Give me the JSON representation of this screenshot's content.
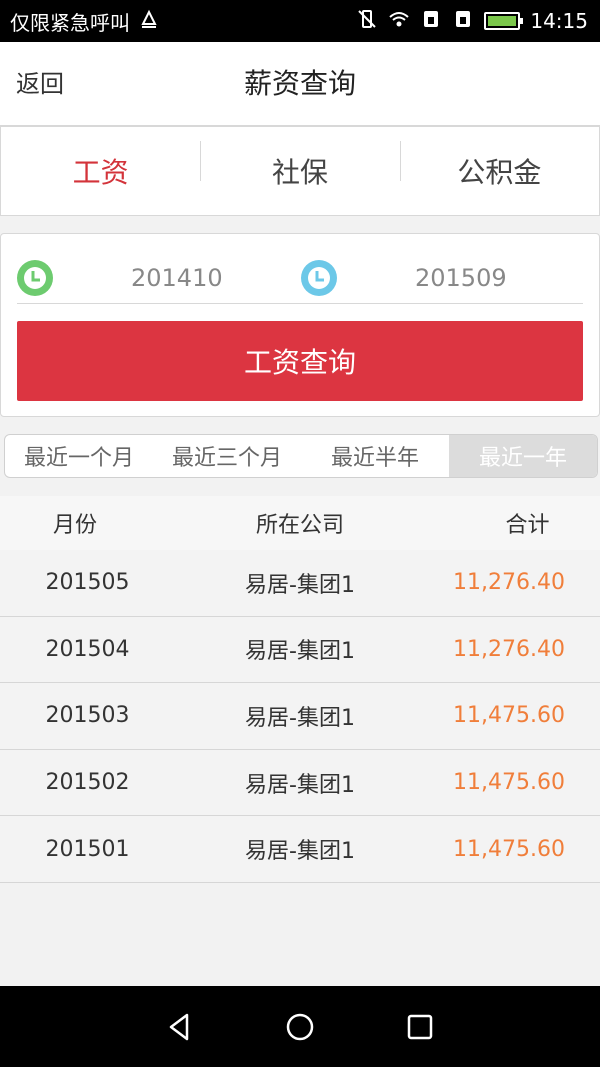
{
  "status_bar": {
    "carrier_text": "仅限紧急呼叫",
    "time": "14:15",
    "battery_color": "#7bc74b"
  },
  "header": {
    "back_label": "返回",
    "title": "薪资查询"
  },
  "tabs": [
    {
      "label": "工资",
      "active": true
    },
    {
      "label": "社保",
      "active": false
    },
    {
      "label": "公积金",
      "active": false
    }
  ],
  "query": {
    "start_date": "201410",
    "end_date": "201509",
    "button_label": "工资查询"
  },
  "ranges": [
    {
      "label": "最近一个月",
      "active": false
    },
    {
      "label": "最近三个月",
      "active": false
    },
    {
      "label": "最近半年",
      "active": false
    },
    {
      "label": "最近一年",
      "active": true
    }
  ],
  "table": {
    "headers": [
      "月份",
      "所在公司",
      "合计"
    ],
    "rows": [
      {
        "month": "201505",
        "company": "易居-集团1",
        "total": "11,276.40"
      },
      {
        "month": "201504",
        "company": "易居-集团1",
        "total": "11,276.40"
      },
      {
        "month": "201503",
        "company": "易居-集团1",
        "total": "11,475.60"
      },
      {
        "month": "201502",
        "company": "易居-集团1",
        "total": "11,475.60"
      },
      {
        "month": "201501",
        "company": "易居-集团1",
        "total": "11,475.60"
      }
    ]
  },
  "colors": {
    "accent_red": "#dc3541",
    "amount_orange": "#f07e3a",
    "start_clock_green": "#6dcb6f",
    "end_clock_blue": "#6cc8e8"
  }
}
